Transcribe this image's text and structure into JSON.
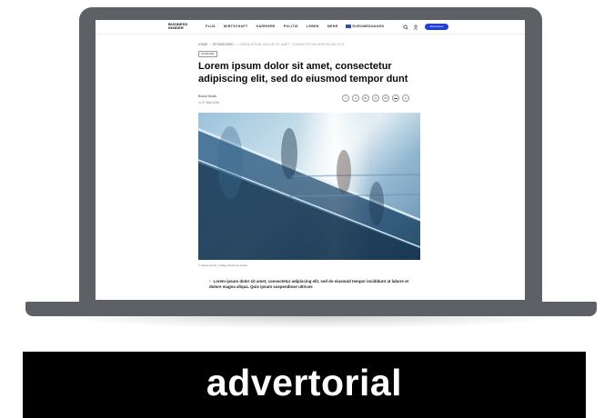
{
  "nav": {
    "logo_line1": "BUSINESS",
    "logo_line2": "INSIDER",
    "items": [
      "PLUS",
      "WIRTSCHAFT",
      "KARRIERE",
      "POLITIK",
      "LEBEN",
      "MEHR",
      "EUROMEDNAKEN"
    ],
    "subscribe_label": "Abonnieren",
    "icons": [
      "search-icon",
      "user-icon"
    ],
    "accent_color": "#1f3fd8"
  },
  "article": {
    "breadcrumb": [
      "HOME",
      "SPONSORED",
      "LOREM IPSUM DOLOR SIT AMET, CONSECTETUR ADIPISCING ELIT"
    ],
    "badge": "ANZEIGE",
    "headline": "Lorem ipsum dolor sit amet, consectetur adipiscing elit, sed do eiusmod tempor dunt",
    "author": "Brand Studio",
    "date": "27 Mai 2020",
    "share_buttons": [
      "facebook-icon",
      "x-icon",
      "linkedin-icon",
      "whatsapp-icon",
      "mail-icon",
      "comment-icon",
      "link-icon"
    ],
    "image_caption": "© Adobe Stock, Collage Business Insider",
    "bullet": "Lorem ipsum dolor sit amet, consectetur adipiscing elit, sed do eiusmod tempor incididunt ut labore et dolore magna aliqua. Quis ipsum suspendisse ultrices"
  },
  "banner": {
    "label": "advertorial"
  }
}
